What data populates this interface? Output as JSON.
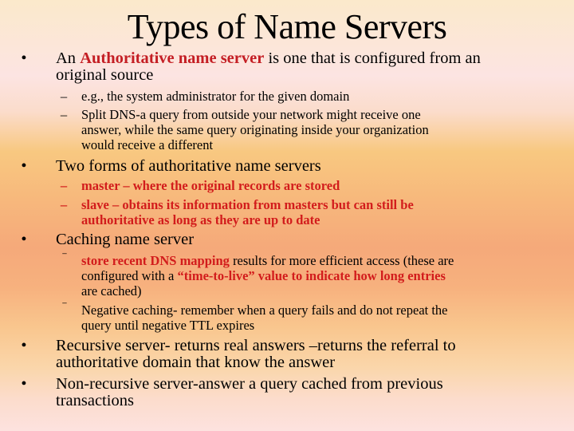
{
  "slide": {
    "title": "Types of Name Servers",
    "bullets": [
      {
        "parts": [
          {
            "text": "An ",
            "style": "normal"
          },
          {
            "text": "Authoritative name server",
            "style": "red-bold"
          },
          {
            "text": " is one that is configured from an original source",
            "style": "normal"
          }
        ],
        "line1_a": "An ",
        "line1_red": "Authoritative name server",
        "line1_b": " is one that is configured from an",
        "line2": "original source",
        "sub": [
          {
            "marker": "–",
            "lines": [
              "e.g., the system administrator for the given domain"
            ]
          },
          {
            "marker": "–",
            "lines": [
              "Split DNS-a query from outside your network might receive one",
              "answer, while the same query originating inside your organization",
              "would receive a different"
            ]
          }
        ]
      },
      {
        "line1": "Two forms of authoritative name servers",
        "sub": [
          {
            "marker": "–",
            "lines": [
              "master – where the original records are stored"
            ],
            "style": "red-bold"
          },
          {
            "marker": "–",
            "lines": [
              "slave – obtains its information from masters but can still be",
              "authoritative as long as they are up to date"
            ],
            "style": "red-bold"
          }
        ]
      },
      {
        "line1": "Caching name server",
        "sub": [
          {
            "marker": "⁻",
            "l1_red": "store recent DNS mapping",
            "l1_rest": " results for more efficient access (these are",
            "l2_a": "configured with a ",
            "l2_red": "“time-to-live” value to indicate how long entries",
            "l3": "are cached)"
          },
          {
            "marker": "⁻",
            "lines": [
              "Negative caching- remember when a query fails and do not repeat the",
              "query until negative TTL expires"
            ]
          }
        ]
      },
      {
        "lines": [
          "Recursive server- returns real answers –returns the referral to",
          "authoritative domain that know the answer"
        ]
      },
      {
        "lines": [
          "Non-recursive server-answer a query cached from previous",
          "transactions"
        ]
      }
    ],
    "bullet_marker": "•",
    "colors": {
      "accent_red": "#C41E24",
      "text": "#000000",
      "background_top": "#FBE9CB",
      "background_mid": "#F5A97A",
      "background_bottom": "#FDE2DF"
    }
  }
}
